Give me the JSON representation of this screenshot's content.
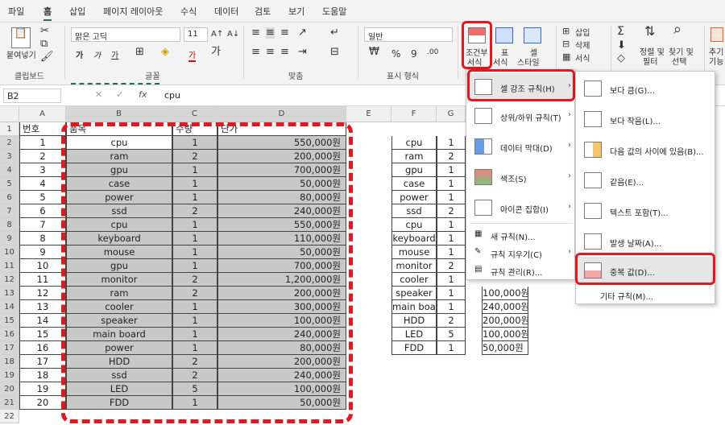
{
  "tabs": [
    "파일",
    "홈",
    "삽입",
    "페이지 레이아웃",
    "수식",
    "데이터",
    "검토",
    "보기",
    "도움말"
  ],
  "active_tab": "홈",
  "ribbon": {
    "paste": "붙여넣기",
    "clipboard": "클립보드",
    "font_name": "맑은 고딕",
    "font_size": "11",
    "font_group": "글꼴",
    "align_group": "맞춤",
    "number_format": "일반",
    "number_group": "표시 형식",
    "cond_format_1": "조건부",
    "cond_format_2": "서식",
    "table_1": "표",
    "table_2": "서식",
    "cell_style_1": "셀",
    "cell_style_2": "스타일",
    "insert": "삽입",
    "delete": "삭제",
    "format": "서식",
    "sort_1": "정렬 및",
    "sort_2": "필터",
    "find_1": "찾기 및",
    "find_2": "선택",
    "add_1": "추기",
    "add_2": "기능",
    "bold": "가",
    "italic": "가",
    "underline": "가",
    "fontcolor": "가",
    "percent": "%",
    "comma": "9"
  },
  "formula_bar": {
    "name_box": "B2",
    "fx": "fx",
    "value": "cpu"
  },
  "columns": [
    "A",
    "B",
    "C",
    "D",
    "E",
    "F",
    "G"
  ],
  "rows": [
    "1",
    "2",
    "3",
    "4",
    "5",
    "6",
    "7",
    "8",
    "9",
    "10",
    "11",
    "12",
    "13",
    "14",
    "15",
    "16",
    "17",
    "18",
    "19",
    "20",
    "21",
    "22"
  ],
  "header_row": {
    "a": "번호",
    "b": "품목",
    "c": "수량",
    "d": "단가"
  },
  "table": [
    {
      "no": "1",
      "item": "cpu",
      "qty": "1",
      "price": "550,000원"
    },
    {
      "no": "2",
      "item": "ram",
      "qty": "2",
      "price": "200,000원"
    },
    {
      "no": "3",
      "item": "gpu",
      "qty": "1",
      "price": "700,000원"
    },
    {
      "no": "4",
      "item": "case",
      "qty": "1",
      "price": "50,000원"
    },
    {
      "no": "5",
      "item": "power",
      "qty": "1",
      "price": "80,000원"
    },
    {
      "no": "6",
      "item": "ssd",
      "qty": "2",
      "price": "240,000원"
    },
    {
      "no": "7",
      "item": "cpu",
      "qty": "1",
      "price": "550,000원"
    },
    {
      "no": "8",
      "item": "keyboard",
      "qty": "1",
      "price": "110,000원"
    },
    {
      "no": "9",
      "item": "mouse",
      "qty": "1",
      "price": "50,000원"
    },
    {
      "no": "10",
      "item": "gpu",
      "qty": "1",
      "price": "700,000원"
    },
    {
      "no": "11",
      "item": "monitor",
      "qty": "2",
      "price": "1,200,000원"
    },
    {
      "no": "12",
      "item": "ram",
      "qty": "2",
      "price": "200,000원"
    },
    {
      "no": "13",
      "item": "cooler",
      "qty": "1",
      "price": "300,000원"
    },
    {
      "no": "14",
      "item": "speaker",
      "qty": "1",
      "price": "100,000원"
    },
    {
      "no": "15",
      "item": "main board",
      "qty": "1",
      "price": "240,000원"
    },
    {
      "no": "16",
      "item": "power",
      "qty": "1",
      "price": "80,000원"
    },
    {
      "no": "17",
      "item": "HDD",
      "qty": "2",
      "price": "200,000원"
    },
    {
      "no": "18",
      "item": "ssd",
      "qty": "2",
      "price": "240,000원"
    },
    {
      "no": "19",
      "item": "LED",
      "qty": "5",
      "price": "100,000원"
    },
    {
      "no": "20",
      "item": "FDD",
      "qty": "1",
      "price": "50,000원"
    }
  ],
  "right_table": [
    {
      "f": "cpu",
      "g": "1",
      "h": ""
    },
    {
      "f": "ram",
      "g": "2",
      "h": ""
    },
    {
      "f": "gpu",
      "g": "1",
      "h": ""
    },
    {
      "f": "case",
      "g": "1",
      "h": ""
    },
    {
      "f": "power",
      "g": "1",
      "h": ""
    },
    {
      "f": "ssd",
      "g": "2",
      "h": ""
    },
    {
      "f": "cpu",
      "g": "1",
      "h": ""
    },
    {
      "f": "keyboard",
      "g": "1",
      "h": ""
    },
    {
      "f": "mouse",
      "g": "1",
      "h": ""
    },
    {
      "f": "monitor",
      "g": "2",
      "h": ""
    },
    {
      "f": "cooler",
      "g": "1",
      "h": ""
    },
    {
      "f": "speaker",
      "g": "1",
      "h": "100,000원"
    },
    {
      "f": "main board",
      "g": "1",
      "h": "240,000원"
    },
    {
      "f": "HDD",
      "g": "2",
      "h": "200,000원"
    },
    {
      "f": "LED",
      "g": "5",
      "h": "100,000원"
    },
    {
      "f": "FDD",
      "g": "1",
      "h": "50,000원"
    }
  ],
  "menu1": [
    "셀 강조 규칙(H)",
    "상위/하위 규칙(T)",
    "데이터 막대(D)",
    "색조(S)",
    "아이콘 집합(I)",
    "새 규칙(N)...",
    "규칙 지우기(C)",
    "규칙 관리(R)..."
  ],
  "menu2": [
    "보다 큼(G)...",
    "보다 작음(L)...",
    "다음 값의 사이에 있음(B)...",
    "같음(E)...",
    "텍스트 포함(T)...",
    "발생 날짜(A)...",
    "중복 값(D)...",
    "기타 규칙(M)..."
  ],
  "colors": {
    "accent": "#217346",
    "highlight_red": "#e0181f",
    "selection": "#c8c8c8"
  }
}
